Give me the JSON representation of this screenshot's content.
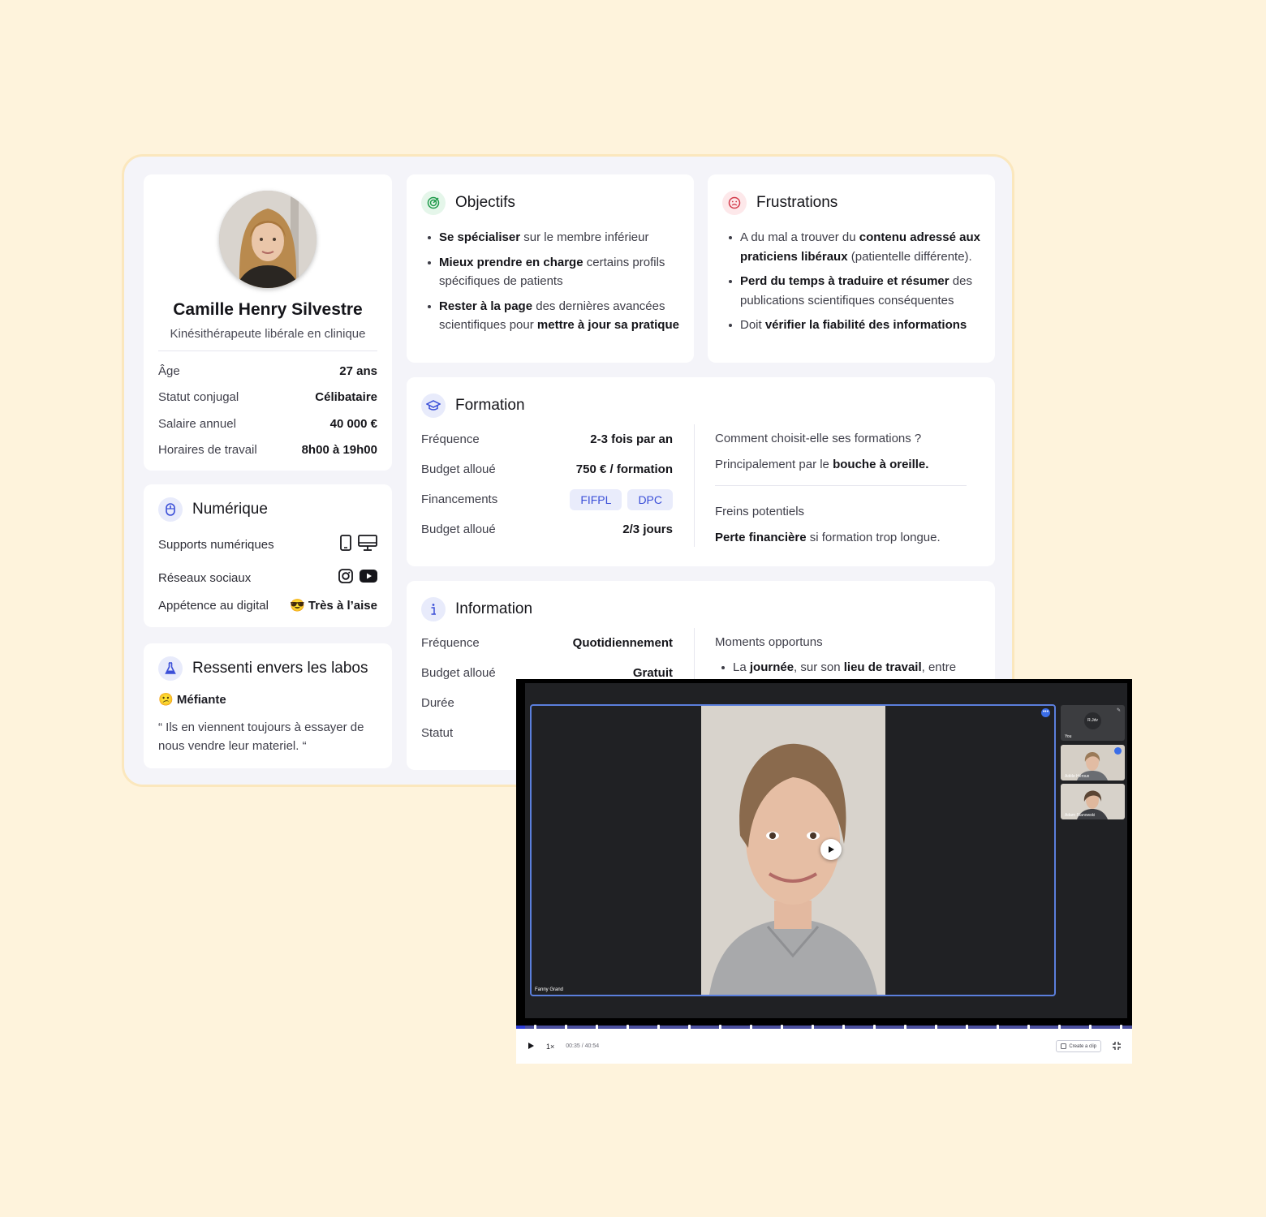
{
  "profile": {
    "name": "Camille Henry Silvestre",
    "role": "Kinésithérapeute libérale en clinique",
    "rows": [
      {
        "label": "Âge",
        "value": "27 ans"
      },
      {
        "label": "Statut conjugal",
        "value": "Célibataire"
      },
      {
        "label": "Salaire annuel",
        "value": "40 000 €"
      },
      {
        "label": "Horaires de travail",
        "value": "8h00 à 19h00"
      }
    ]
  },
  "numerique": {
    "title": "Numérique",
    "supports_label": "Supports numériques",
    "reseaux_label": "Réseaux sociaux",
    "appetence_label": "Appétence au digital",
    "appetence_emoji": "😎",
    "appetence_value": "Très à l’aise"
  },
  "labos": {
    "title": "Ressenti envers les labos",
    "emoji": "😕",
    "sentiment": "Méfiante",
    "quote": "“ Ils en viennent toujours à essayer de nous vendre leur materiel. “"
  },
  "objectifs": {
    "title": "Objectifs",
    "items": [
      {
        "b": "Se spécialiser",
        "t": " sur le membre inférieur"
      },
      {
        "b": "Mieux prendre en charge",
        "t": " certains profils spécifiques de patients"
      },
      {
        "b": "Rester à la page",
        "t": " des dernières avancées scientifiques pour ",
        "b2": "mettre à jour sa pratique"
      }
    ]
  },
  "frustrations": {
    "title": "Frustrations",
    "items": [
      {
        "t": "A du mal a trouver du ",
        "b": "contenu adressé aux praticiens libéraux",
        "t2": " (patientelle différente)."
      },
      {
        "b": "Perd du temps à traduire et résumer",
        "t": " des publications scientifiques conséquentes"
      },
      {
        "t": "Doit ",
        "b": "vérifier la fiabilité des informations"
      }
    ]
  },
  "formation": {
    "title": "Formation",
    "rows": [
      {
        "label": "Fréquence",
        "value": "2-3 fois par an"
      },
      {
        "label": "Budget alloué",
        "value": "750 € / formation"
      },
      {
        "label": "Financements",
        "tags": [
          "FIFPL",
          "DPC"
        ]
      },
      {
        "label": "Budget alloué",
        "value": "2/3 jours"
      }
    ],
    "question": "Comment choisit-elle ses formations ?",
    "answer_pre": "Principalement par le ",
    "answer_bold": "bouche à oreille.",
    "freins_label": "Freins potentiels",
    "freins_bold": "Perte financière",
    "freins_rest": " si formation trop longue."
  },
  "information": {
    "title": "Information",
    "rows": [
      {
        "label": "Fréquence",
        "value": "Quotidiennement"
      },
      {
        "label": "Budget alloué",
        "value": "Gratuit"
      },
      {
        "label": "Durée",
        "value": ""
      },
      {
        "label": "Statut",
        "value": ""
      }
    ],
    "moments_label": "Moments opportuns",
    "moment_1_pre": "La ",
    "moment_1_b1": "journée",
    "moment_1_mid": ", sur son ",
    "moment_1_b2": "lieu de travail",
    "moment_1_post": ", entre"
  },
  "video": {
    "main_participant": "Fanny Grand",
    "you_initials": "R.Jdv",
    "you_label": "You",
    "thumb_2": "Adèle Héroux",
    "thumb_3": "Adam Stanowski",
    "speed": "1×",
    "time": "00:35 / 40:54",
    "progress": 0.014,
    "create_clip": "Create a clip"
  },
  "colors": {
    "accent": "#3b4fd8",
    "background": "#fef3dc"
  }
}
